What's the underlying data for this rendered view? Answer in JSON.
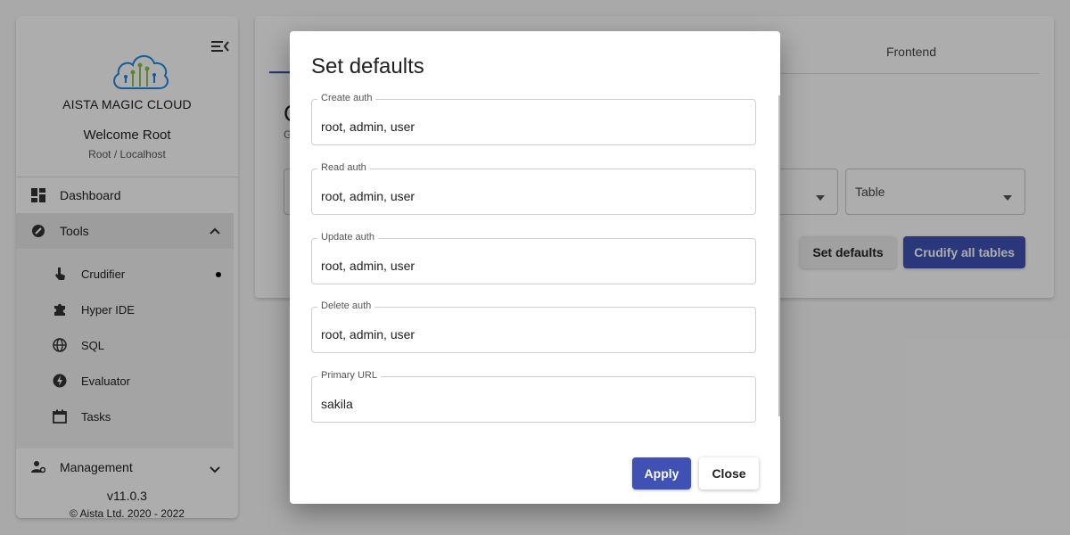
{
  "sidebar": {
    "brand": "AISTA MAGIC CLOUD",
    "welcome": "Welcome Root",
    "user_sub": "Root / Localhost",
    "dashboard_label": "Dashboard",
    "tools_label": "Tools",
    "tools_items": [
      {
        "label": "Crudifier",
        "icon": "touch-icon",
        "active": true
      },
      {
        "label": "Hyper IDE",
        "icon": "puzzle-icon"
      },
      {
        "label": "SQL",
        "icon": "globe-icon"
      },
      {
        "label": "Evaluator",
        "icon": "bolt-icon"
      },
      {
        "label": "Tasks",
        "icon": "calendar-icon"
      }
    ],
    "management_label": "Management",
    "version": "v11.0.3",
    "copyright": "© Aista Ltd. 2020 - 2022"
  },
  "main": {
    "tab_frontend": "Frontend",
    "title": "C",
    "subtitle": "G",
    "table_select_label": "Table",
    "set_defaults_label": "Set defaults",
    "crudify_all_label": "Crudify all tables"
  },
  "dialog": {
    "title": "Set defaults",
    "fields": [
      {
        "label": "Create auth",
        "value": "root, admin, user"
      },
      {
        "label": "Read auth",
        "value": "root, admin, user"
      },
      {
        "label": "Update auth",
        "value": "root, admin, user"
      },
      {
        "label": "Delete auth",
        "value": "root, admin, user"
      },
      {
        "label": "Primary URL",
        "value": "sakila"
      }
    ],
    "apply_label": "Apply",
    "close_label": "Close"
  },
  "colors": {
    "primary": "#3f51b5",
    "logo_green": "#8bc34a",
    "logo_blue": "#1e88e5"
  }
}
